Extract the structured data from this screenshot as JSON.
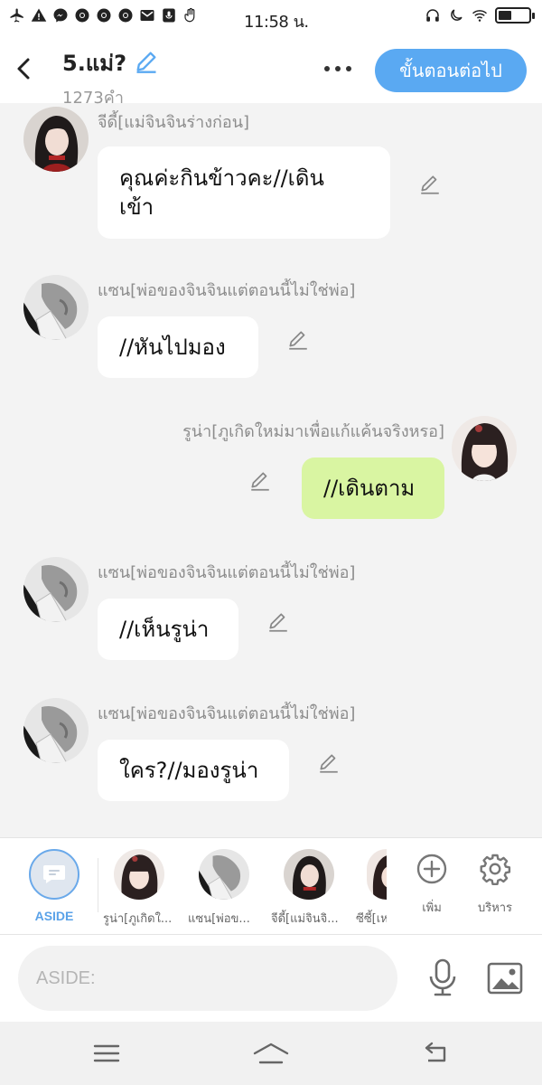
{
  "status_bar": {
    "time": "11:58 น.",
    "battery_level": 0.45
  },
  "header": {
    "title": "5.แม่?",
    "word_count": "1273คำ",
    "next_button": "ขั้นตอนต่อไป"
  },
  "messages": [
    {
      "sender": "จีดี้[แม่จินจินร่างก่อน]",
      "text": "คุณค่ะกินข้าวคะ//เดิน\nเข้า",
      "side": "left"
    },
    {
      "sender": "แซน[พ่อของจินจินแต่ตอนนี้ไม่ใช่พ่อ]",
      "text": "//หันไปมอง",
      "side": "left"
    },
    {
      "sender": "รูน่า[ภูเกิดใหม่มาเพื่อแก้แค้นจริงหรอ]",
      "text": "//เดินตาม",
      "side": "right"
    },
    {
      "sender": "แซน[พ่อของจินจินแต่ตอนนี้ไม่ใช่พ่อ]",
      "text": "//เห็นรูน่า",
      "side": "left"
    },
    {
      "sender": "แซน[พ่อของจินจินแต่ตอนนี้ไม่ใช่พ่อ]",
      "text": "ใคร?//มองรูน่า",
      "side": "left"
    }
  ],
  "character_bar": {
    "aside_label": "ASIDE",
    "characters": [
      {
        "label": "รูน่า[ภูเกิดใ..."
      },
      {
        "label": "แซน[พ่อข..."
      },
      {
        "label": "จีดี้[แม่จินจิ..."
      },
      {
        "label": "ซีซี้[เห"
      }
    ],
    "add_label": "เพิ่ม",
    "manage_label": "บริหาร"
  },
  "input": {
    "placeholder": "ASIDE:"
  },
  "colors": {
    "accent": "#5aa9f2",
    "my_bubble": "#d9f5a2",
    "background": "#f3f3f3"
  }
}
